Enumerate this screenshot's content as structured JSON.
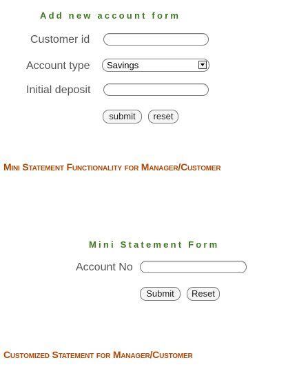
{
  "add_account_form": {
    "title": "Add new account form",
    "customer_id_label": "Customer id",
    "account_type_label": "Account type",
    "account_type_value": "Savings",
    "initial_deposit_label": "Initial deposit",
    "submit_label": "submit",
    "reset_label": "reset"
  },
  "mini_statement_heading": "Mini Statement Functionality for Manager/Customer",
  "mini_statement_form": {
    "title": "Mini Statement Form",
    "account_no_label": "Account No",
    "submit_label": "Submit",
    "reset_label": "Reset"
  },
  "customized_statement_heading": "Customized Statement for Manager/Customer",
  "colors": {
    "form_title": "#3c7a1e",
    "section_heading": "#b34700",
    "label": "#555555"
  }
}
